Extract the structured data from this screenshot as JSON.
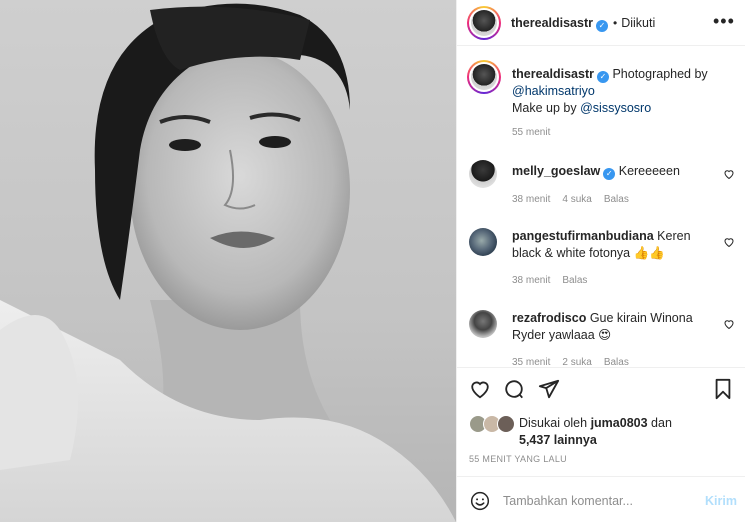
{
  "post": {
    "username": "therealdisastr",
    "follow_status": "Diikuti",
    "caption_line1": "Photographed by",
    "caption_mention1": "@hakimsatriyo",
    "caption_line2": "Make up by",
    "caption_mention2": "@sissysosro",
    "caption_time": "55 menit"
  },
  "comments": [
    {
      "username": "melly_goeslaw",
      "text": "Kereeeeen",
      "time": "38 menit",
      "likes": "4 suka",
      "reply": "Balas"
    },
    {
      "username": "pangestufirmanbudiana",
      "text": "Keren black & white fotonya",
      "emoji": "👍👍",
      "time": "38 menit",
      "reply": "Balas"
    },
    {
      "username": "rezafrodisco",
      "text": "Gue kirain Winona Ryder yawlaaa",
      "emoji": "😍",
      "time": "35 menit",
      "likes": "2 suka",
      "reply": "Balas"
    }
  ],
  "likes": {
    "prefix": "Disukai oleh",
    "user": "juma0803",
    "conj": "dan",
    "others": "5,437 lainnya"
  },
  "posted_ago": "55 MENIT YANG LALU",
  "add_comment": {
    "placeholder": "Tambahkan komentar...",
    "post_label": "Kirim"
  },
  "colors": {
    "verified": "#3897f0",
    "link": "#00376b",
    "muted": "#8e8e8e",
    "post_disabled": "#b2dffc"
  },
  "icons": [
    "more-options-icon",
    "heart-icon",
    "comment-icon",
    "share-icon",
    "bookmark-icon",
    "emoji-icon",
    "verified-icon"
  ]
}
